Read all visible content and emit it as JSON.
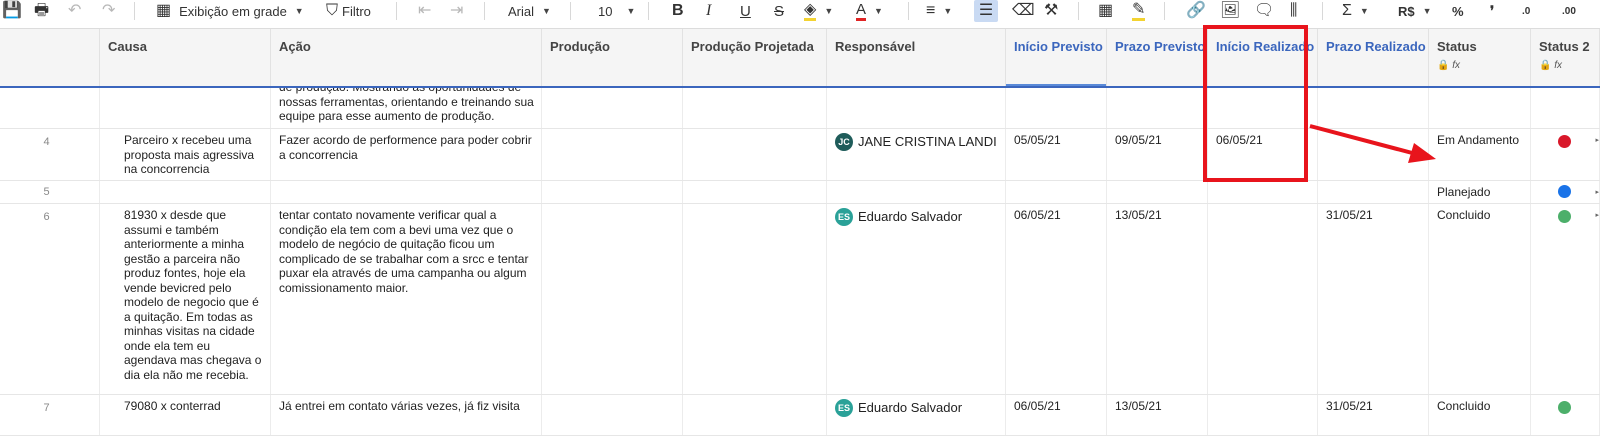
{
  "toolbar": {
    "view_label": "Exibição em grade",
    "filter_label": "Filtro",
    "font_name": "Arial",
    "font_size": "10",
    "bold": "B",
    "italic": "I",
    "underline": "U",
    "strike": "S",
    "currency": "R$",
    "percent": "%",
    "thousands": "❜",
    "dec_less": ".0",
    "dec_more": ".00",
    "sum": "Σ",
    "text_color_letter": "A"
  },
  "columns": {
    "causa": "Causa",
    "acao": "Ação",
    "producao": "Produção",
    "producao_projetada": "Produção Projetada",
    "responsavel": "Responsável",
    "inicio_previsto": "Início Previsto",
    "prazo_previsto": "Prazo Previsto",
    "inicio_realizado": "Início Realizado",
    "prazo_realizado": "Prazo Realizado",
    "status": "Status",
    "status2": "Status 2"
  },
  "header_icons": {
    "lock": "🔒",
    "fx": "fx"
  },
  "rows": [
    {
      "num": "",
      "causa": "",
      "acao": "de produção. Mostrando as oportunidades de nossas ferramentas, orientando e treinando sua equipe para esse aumento de produção.",
      "responsavel": "",
      "initials": "",
      "av_color": "",
      "inicio_previsto": "",
      "prazo_previsto": "",
      "inicio_realizado": "",
      "prazo_realizado": "",
      "status": "",
      "dot": ""
    },
    {
      "num": "4",
      "causa": "Parceiro x recebeu uma proposta mais agressiva na concorrencia",
      "acao": "Fazer acordo de performence para poder cobrir a concorrencia",
      "responsavel": "JANE CRISTINA LANDI",
      "initials": "JC",
      "av_color": "#1f5c5a",
      "inicio_previsto": "05/05/21",
      "prazo_previsto": "09/05/21",
      "inicio_realizado": "06/05/21",
      "prazo_realizado": "",
      "status": "Em Andamento",
      "dot": "#d9182a"
    },
    {
      "num": "5",
      "causa": "",
      "acao": "",
      "responsavel": "",
      "initials": "",
      "av_color": "",
      "inicio_previsto": "",
      "prazo_previsto": "",
      "inicio_realizado": "",
      "prazo_realizado": "",
      "status": "Planejado",
      "dot": "#1a73e8"
    },
    {
      "num": "6",
      "causa": "81930 x desde que assumi e também anteriormente a minha gestão a parceira não produz fontes, hoje ela vende bevicred pelo modelo de negocio que é a quitação. Em todas as minhas visitas na cidade onde ela tem eu agendava mas chegava o dia ela não me recebia.",
      "acao": "tentar contato novamente verificar qual a condição ela tem com a bevi uma vez que o modelo de negócio de quitação ficou um complicado de se trabalhar com a srcc e tentar puxar ela através de uma campanha ou algum comissionamento maior.",
      "responsavel": "Eduardo Salvador",
      "initials": "ES",
      "av_color": "#2aa198",
      "inicio_previsto": "06/05/21",
      "prazo_previsto": "13/05/21",
      "inicio_realizado": "",
      "prazo_realizado": "31/05/21",
      "status": "Concluido",
      "dot": "#4caf6a"
    },
    {
      "num": "7",
      "causa": "79080 x conterrad",
      "acao": "Já entrei em contato várias vezes, já fiz visita",
      "responsavel": "Eduardo Salvador",
      "initials": "ES",
      "av_color": "#2aa198",
      "inicio_previsto": "06/05/21",
      "prazo_previsto": "13/05/21",
      "inicio_realizado": "",
      "prazo_realizado": "31/05/21",
      "status": "Concluido",
      "dot": "#4caf6a"
    }
  ]
}
